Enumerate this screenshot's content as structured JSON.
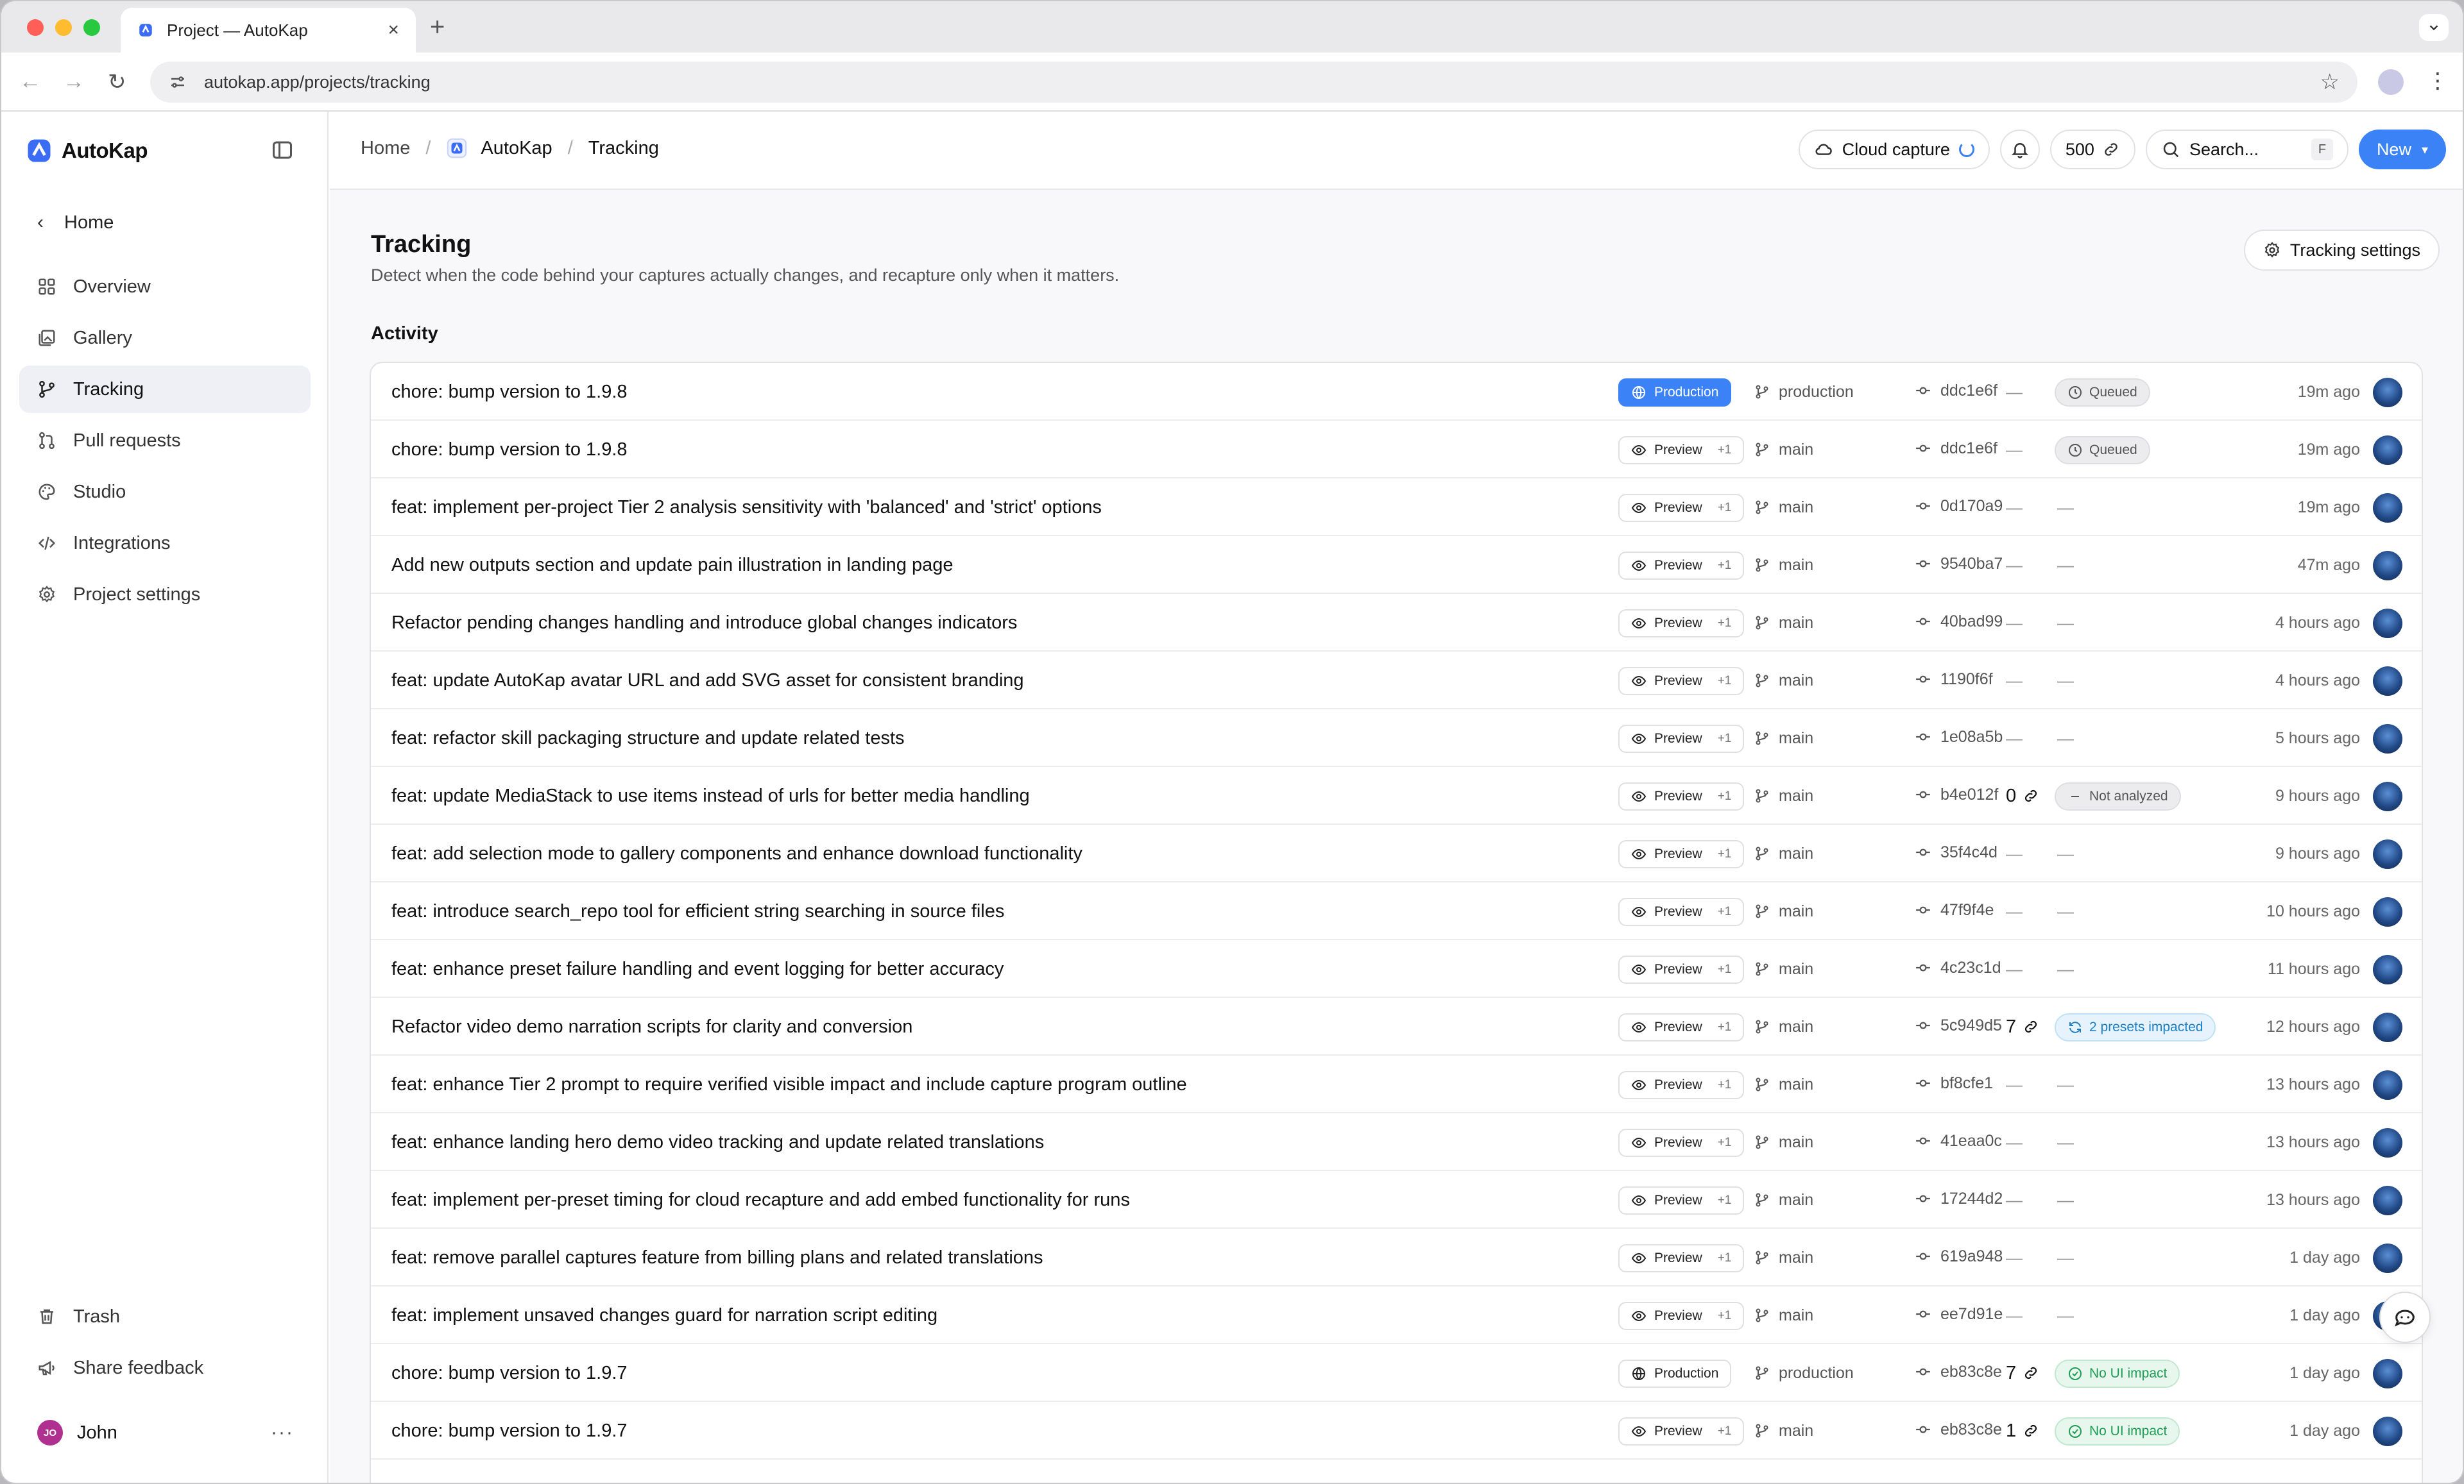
{
  "browser": {
    "tab_title": "Project — AutoKap",
    "url": "autokap.app/projects/tracking"
  },
  "sidebar": {
    "brand": "AutoKap",
    "home": "Home",
    "items": [
      {
        "label": "Overview",
        "icon": "grid-icon"
      },
      {
        "label": "Gallery",
        "icon": "gallery-icon"
      },
      {
        "label": "Tracking",
        "icon": "branch-icon",
        "active": true
      },
      {
        "label": "Pull requests",
        "icon": "pull-request-icon"
      },
      {
        "label": "Studio",
        "icon": "palette-icon"
      },
      {
        "label": "Integrations",
        "icon": "code-icon"
      },
      {
        "label": "Project settings",
        "icon": "gear-icon"
      }
    ],
    "bottom": [
      {
        "label": "Trash",
        "icon": "trash-icon"
      },
      {
        "label": "Share feedback",
        "icon": "megaphone-icon"
      }
    ],
    "user": {
      "initials": "JO",
      "name": "John"
    }
  },
  "topbar": {
    "breadcrumb": {
      "home": "Home",
      "project": "AutoKap",
      "current": "Tracking"
    },
    "cloud_capture": "Cloud capture",
    "credits": "500",
    "search_placeholder": "Search...",
    "search_shortcut": "F",
    "new_label": "New"
  },
  "page": {
    "title": "Tracking",
    "subtitle": "Detect when the code behind your captures actually changes, and recapture only when it matters.",
    "settings_label": "Tracking settings",
    "section": "Activity"
  },
  "activity": [
    {
      "message": "chore: bump version to 1.9.8",
      "env": "Production",
      "env_style": "prod-blue",
      "branch": "production",
      "commit": "ddc1e6f",
      "count": "—",
      "status": "Queued",
      "status_type": "queued",
      "time": "19m ago"
    },
    {
      "message": "chore: bump version to 1.9.8",
      "env": "Preview",
      "env_extra": "+1",
      "branch": "main",
      "commit": "ddc1e6f",
      "count": "—",
      "status": "Queued",
      "status_type": "queued",
      "time": "19m ago"
    },
    {
      "message": "feat: implement per-project Tier 2 analysis sensitivity with 'balanced' and 'strict' options",
      "env": "Preview",
      "env_extra": "+1",
      "branch": "main",
      "commit": "0d170a9",
      "time": "19m ago"
    },
    {
      "message": "Add new outputs section and update pain illustration in landing page",
      "env": "Preview",
      "env_extra": "+1",
      "branch": "main",
      "commit": "9540ba7",
      "time": "47m ago"
    },
    {
      "message": "Refactor pending changes handling and introduce global changes indicators",
      "env": "Preview",
      "env_extra": "+1",
      "branch": "main",
      "commit": "40bad99",
      "time": "4 hours ago"
    },
    {
      "message": "feat: update AutoKap avatar URL and add SVG asset for consistent branding",
      "env": "Preview",
      "env_extra": "+1",
      "branch": "main",
      "commit": "1190f6f",
      "time": "4 hours ago"
    },
    {
      "message": "feat: refactor skill packaging structure and update related tests",
      "env": "Preview",
      "env_extra": "+1",
      "branch": "main",
      "commit": "1e08a5b",
      "time": "5 hours ago"
    },
    {
      "message": "feat: update MediaStack to use items instead of urls for better media handling",
      "env": "Preview",
      "env_extra": "+1",
      "branch": "main",
      "commit": "b4e012f",
      "count": "0",
      "status": "Not analyzed",
      "status_type": "notanalyzed",
      "time": "9 hours ago"
    },
    {
      "message": "feat: add selection mode to gallery components and enhance download functionality",
      "env": "Preview",
      "env_extra": "+1",
      "branch": "main",
      "commit": "35f4c4d",
      "time": "9 hours ago"
    },
    {
      "message": "feat: introduce search_repo tool for efficient string searching in source files",
      "env": "Preview",
      "env_extra": "+1",
      "branch": "main",
      "commit": "47f9f4e",
      "time": "10 hours ago"
    },
    {
      "message": "feat: enhance preset failure handling and event logging for better accuracy",
      "env": "Preview",
      "env_extra": "+1",
      "branch": "main",
      "commit": "4c23c1d",
      "time": "11 hours ago"
    },
    {
      "message": "Refactor video demo narration scripts for clarity and conversion",
      "env": "Preview",
      "env_extra": "+1",
      "branch": "main",
      "commit": "5c949d5",
      "count": "7",
      "status": "2 presets impacted",
      "status_type": "impacted",
      "time": "12 hours ago"
    },
    {
      "message": "feat: enhance Tier 2 prompt to require verified visible impact and include capture program outline",
      "env": "Preview",
      "env_extra": "+1",
      "branch": "main",
      "commit": "bf8cfe1",
      "time": "13 hours ago"
    },
    {
      "message": "feat: enhance landing hero demo video tracking and update related translations",
      "env": "Preview",
      "env_extra": "+1",
      "branch": "main",
      "commit": "41eaa0c",
      "time": "13 hours ago"
    },
    {
      "message": "feat: implement per-preset timing for cloud recapture and add embed functionality for runs",
      "env": "Preview",
      "env_extra": "+1",
      "branch": "main",
      "commit": "17244d2",
      "time": "13 hours ago"
    },
    {
      "message": "feat: remove parallel captures feature from billing plans and related translations",
      "env": "Preview",
      "env_extra": "+1",
      "branch": "main",
      "commit": "619a948",
      "time": "1 day ago"
    },
    {
      "message": "feat: implement unsaved changes guard for narration script editing",
      "env": "Preview",
      "env_extra": "+1",
      "branch": "main",
      "commit": "ee7d91e",
      "time": "1 day ago"
    },
    {
      "message": "chore: bump version to 1.9.7",
      "env": "Production",
      "env_style": "prod-outline",
      "branch": "production",
      "commit": "eb83c8e",
      "count": "7",
      "status": "No UI impact",
      "status_type": "noimpact",
      "time": "1 day ago"
    },
    {
      "message": "chore: bump version to 1.9.7",
      "env": "Preview",
      "env_extra": "+1",
      "branch": "main",
      "commit": "eb83c8e",
      "count": "1",
      "status": "No UI impact",
      "status_type": "noimpact",
      "time": "1 day ago"
    }
  ],
  "colors": {
    "accent": "#3b82f6",
    "active_nav_bg": "#eef0f5"
  }
}
